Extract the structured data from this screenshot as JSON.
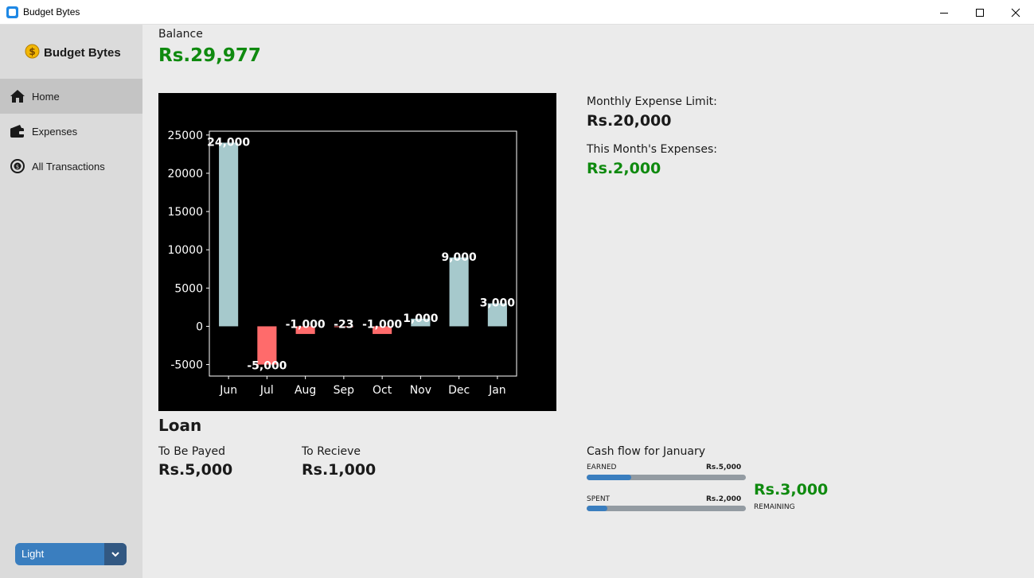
{
  "window": {
    "title": "Budget Bytes"
  },
  "sidebar": {
    "brand": "Budget Bytes",
    "items": [
      {
        "label": "Home",
        "icon": "home-icon",
        "active": true
      },
      {
        "label": "Expenses",
        "icon": "wallet-icon",
        "active": false
      },
      {
        "label": "All Transactions",
        "icon": "transactions-icon",
        "active": false
      }
    ],
    "theme": {
      "selected": "Light"
    }
  },
  "balance": {
    "label": "Balance",
    "value": "Rs.29,977"
  },
  "limits": {
    "limit_label": "Monthly Expense Limit:",
    "limit_value": "Rs.20,000",
    "expenses_label": "This Month's Expenses:",
    "expenses_value": "Rs.2,000"
  },
  "loan": {
    "title": "Loan",
    "payable_label": "To Be Payed",
    "payable_value": "Rs.5,000",
    "receivable_label": "To Recieve",
    "receivable_value": "Rs.1,000"
  },
  "cashflow": {
    "title": "Cash flow for January",
    "earned_label": "EARNED",
    "earned_value": "Rs.5,000",
    "earned_fraction": 0.28,
    "spent_label": "SPENT",
    "spent_value": "Rs.2,000",
    "spent_fraction": 0.13,
    "remaining_value": "Rs.3,000",
    "remaining_label": "REMAINING"
  },
  "colors": {
    "positive": "#a6c9cc",
    "negative": "#ff6b6b",
    "accent": "#3a7ebf",
    "green": "#0f8a0f"
  },
  "chart_data": {
    "type": "bar",
    "categories": [
      "Jun",
      "Jul",
      "Aug",
      "Sep",
      "Oct",
      "Nov",
      "Dec",
      "Jan"
    ],
    "values": [
      24000,
      -5000,
      -1000,
      -23,
      -1000,
      1000,
      9000,
      3000
    ],
    "labels": [
      "24,000",
      "-5,000",
      "-1,000",
      "-23",
      "-1,000",
      "1,000",
      "9,000",
      "3,000"
    ],
    "yticks": [
      -5000,
      0,
      5000,
      10000,
      15000,
      20000,
      25000
    ],
    "ylim": [
      -6500,
      25500
    ],
    "grid": false,
    "background": "#000000"
  }
}
